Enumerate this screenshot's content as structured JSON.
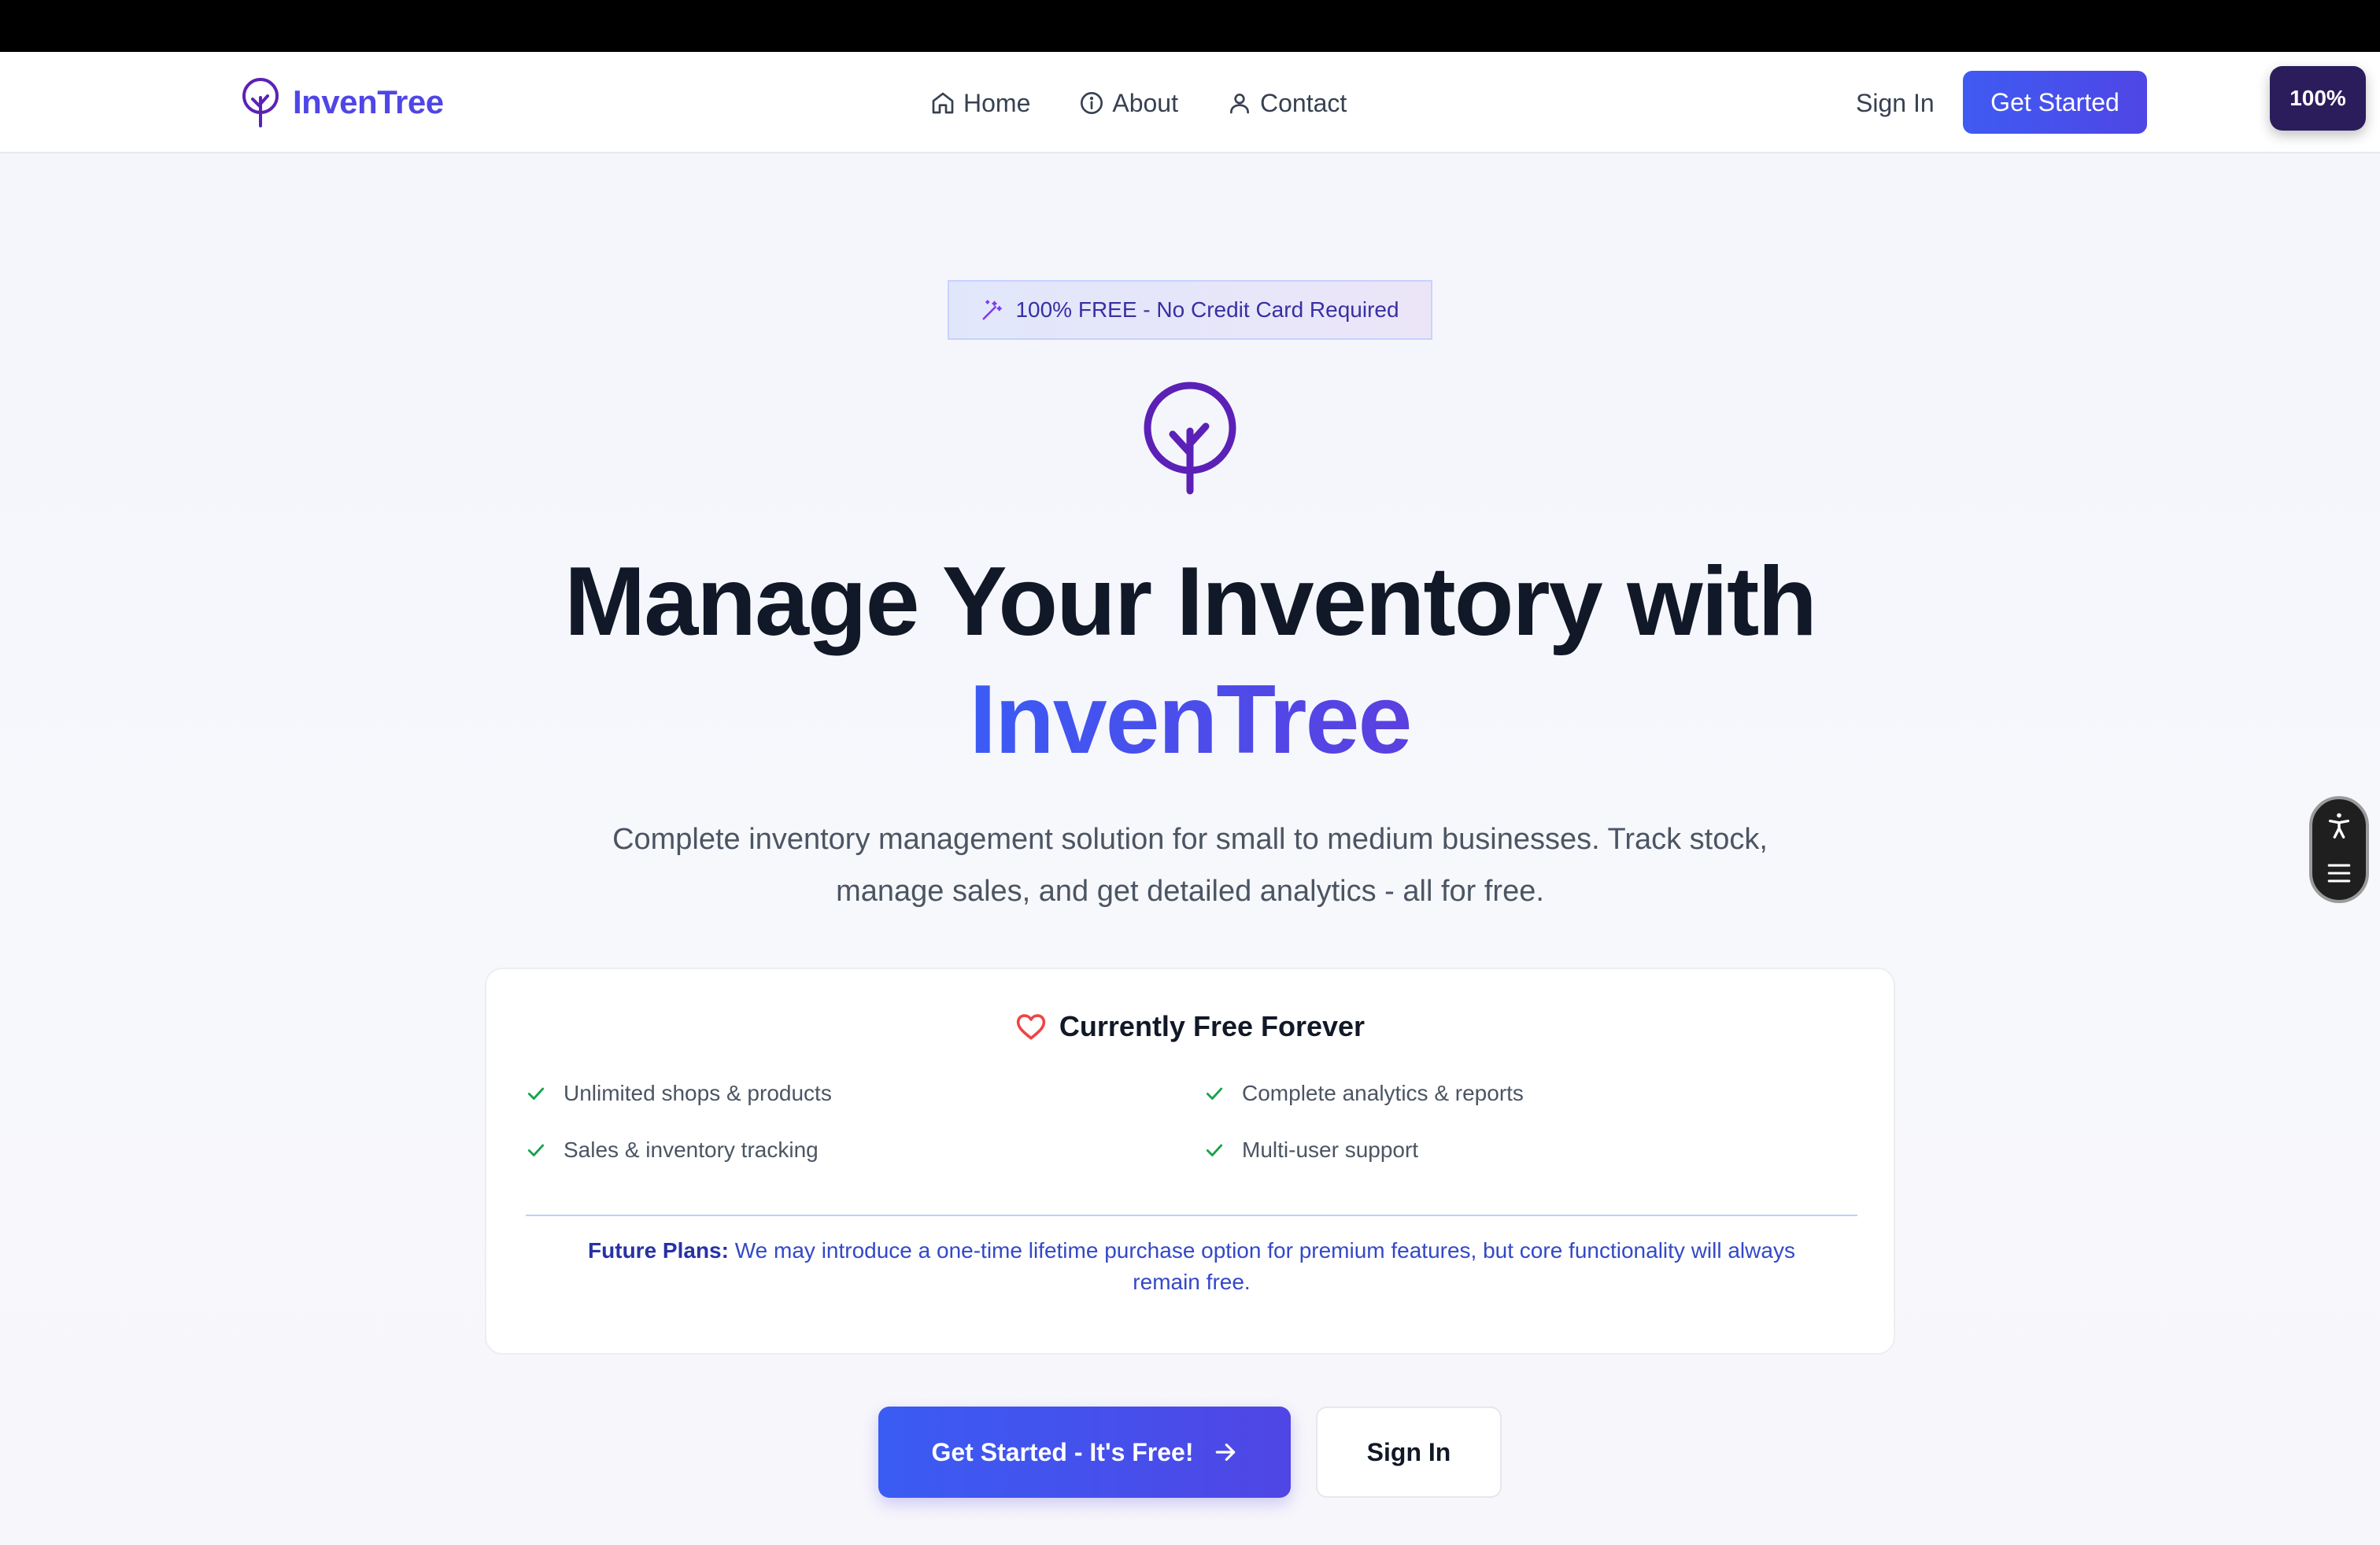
{
  "nav": {
    "brand": "InvenTree",
    "links": [
      {
        "label": "Home",
        "icon": "home-icon"
      },
      {
        "label": "About",
        "icon": "info-icon"
      },
      {
        "label": "Contact",
        "icon": "user-icon"
      }
    ],
    "sign_in": "Sign In",
    "get_started": "Get Started"
  },
  "zoom": "100%",
  "hero": {
    "badge": "100% FREE - No Credit Card Required",
    "title_line1": "Manage Your Inventory with",
    "title_line2": "InvenTree",
    "subtitle": "Complete inventory management solution for small to medium businesses. Track stock, manage sales, and get detailed analytics - all for free."
  },
  "card": {
    "title": "Currently Free Forever",
    "features": [
      "Unlimited shops & products",
      "Complete analytics & reports",
      "Sales & inventory tracking",
      "Multi-user support"
    ],
    "future_label": "Future Plans:",
    "future_text": " We may introduce a one-time lifetime purchase option for premium features, but core functionality will always remain free."
  },
  "cta": {
    "primary": "Get Started - It's Free!",
    "secondary": "Sign In"
  },
  "colors": {
    "brand": "#4f46e5",
    "logo_purple": "#5b21b6",
    "check_green": "#16a34a",
    "heart_red": "#ef4444"
  }
}
